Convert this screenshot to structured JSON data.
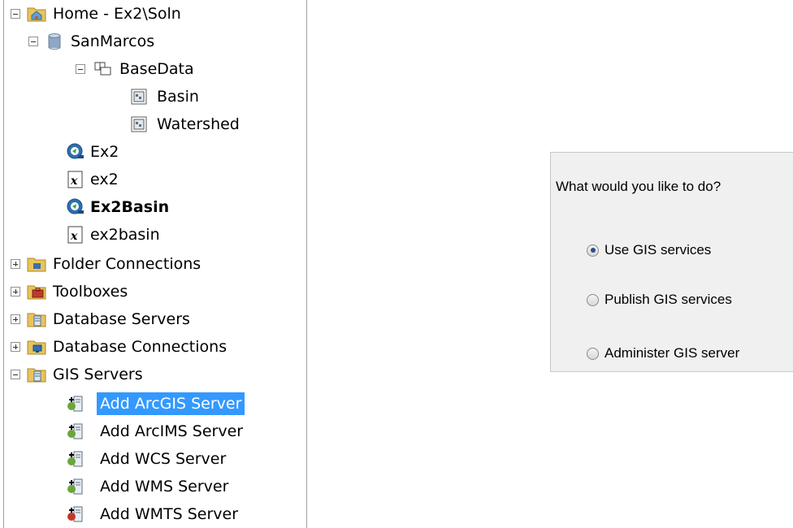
{
  "tree": {
    "items": [
      {
        "label": "Home - Ex2\\Soln",
        "icon": "home-folder-icon",
        "expander": "minus"
      },
      {
        "label": "SanMarcos",
        "icon": "geodatabase-icon",
        "expander": "minus"
      },
      {
        "label": "BaseData",
        "icon": "feature-dataset-icon",
        "expander": "minus"
      },
      {
        "label": "Basin",
        "icon": "feature-class-icon"
      },
      {
        "label": "Watershed",
        "icon": "feature-class-icon"
      },
      {
        "label": "Ex2",
        "icon": "map-document-icon"
      },
      {
        "label": "ex2",
        "icon": "xml-file-icon"
      },
      {
        "label": "Ex2Basin",
        "icon": "map-document-icon"
      },
      {
        "label": "ex2basin",
        "icon": "xml-file-icon"
      },
      {
        "label": "Folder Connections",
        "icon": "folder-connection-icon",
        "expander": "plus"
      },
      {
        "label": "Toolboxes",
        "icon": "toolbox-icon",
        "expander": "plus"
      },
      {
        "label": "Database Servers",
        "icon": "database-server-icon",
        "expander": "plus"
      },
      {
        "label": "Database Connections",
        "icon": "database-connection-icon",
        "expander": "plus"
      },
      {
        "label": "GIS Servers",
        "icon": "gis-servers-icon",
        "expander": "minus"
      },
      {
        "label": "Add ArcGIS Server",
        "icon": "add-server-icon",
        "selected": true
      },
      {
        "label": "Add ArcIMS Server",
        "icon": "add-server-icon"
      },
      {
        "label": "Add WCS Server",
        "icon": "add-server-icon"
      },
      {
        "label": "Add WMS Server",
        "icon": "add-server-icon"
      },
      {
        "label": "Add WMTS Server",
        "icon": "add-server-icon"
      }
    ]
  },
  "dialog": {
    "prompt": "What would you like to do?",
    "options": [
      {
        "label": "Use GIS services",
        "checked": true
      },
      {
        "label": "Publish GIS services",
        "checked": false
      },
      {
        "label": "Administer GIS server",
        "checked": false
      }
    ]
  },
  "colors": {
    "selection": "#3399ff",
    "panel_bg": "#f0f0f0"
  }
}
